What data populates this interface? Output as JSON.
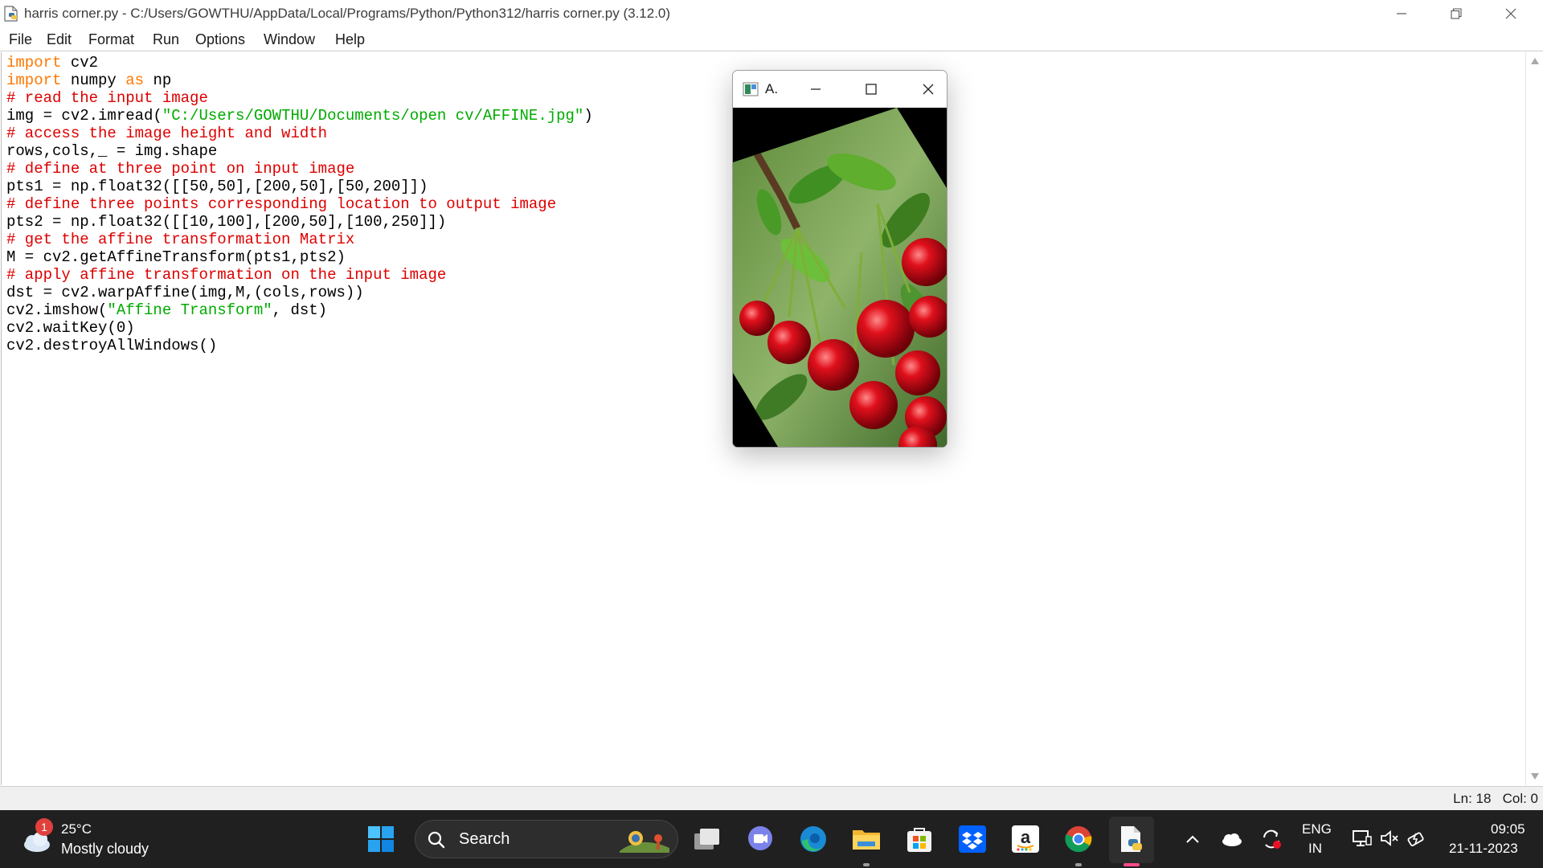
{
  "window": {
    "title": "harris corner.py - C:/Users/GOWTHU/AppData/Local/Programs/Python/Python312/harris corner.py (3.12.0)",
    "icons": [
      "python-file-icon",
      "minimize-icon",
      "restore-icon",
      "close-icon"
    ]
  },
  "menu": {
    "items": [
      "File",
      "Edit",
      "Format",
      "Run",
      "Options",
      "Window",
      "Help"
    ]
  },
  "editor": {
    "colors": {
      "keyword": "#ff7700",
      "comment": "#dd0000",
      "string": "#00aa00",
      "text": "#000000"
    },
    "lines": [
      [
        {
          "t": "kw",
          "v": "import"
        },
        {
          "t": "tx",
          "v": " cv2"
        }
      ],
      [
        {
          "t": "kw",
          "v": "import"
        },
        {
          "t": "tx",
          "v": " numpy "
        },
        {
          "t": "kw",
          "v": "as"
        },
        {
          "t": "tx",
          "v": " np"
        }
      ],
      [
        {
          "t": "cm",
          "v": "# read the input image"
        }
      ],
      [
        {
          "t": "tx",
          "v": "img = cv2.imread("
        },
        {
          "t": "st",
          "v": "\"C:/Users/GOWTHU/Documents/open cv/AFFINE.jpg\""
        },
        {
          "t": "tx",
          "v": ")"
        }
      ],
      [
        {
          "t": "cm",
          "v": "# access the image height and width"
        }
      ],
      [
        {
          "t": "tx",
          "v": "rows,cols,_ = img.shape"
        }
      ],
      [
        {
          "t": "cm",
          "v": "# define at three point on input image"
        }
      ],
      [
        {
          "t": "tx",
          "v": "pts1 = np.float32([[50,50],[200,50],[50,200]])"
        }
      ],
      [
        {
          "t": "cm",
          "v": "# define three points corresponding location to output image"
        }
      ],
      [
        {
          "t": "tx",
          "v": "pts2 = np.float32([[10,100],[200,50],[100,250]])"
        }
      ],
      [
        {
          "t": "cm",
          "v": "# get the affine transformation Matrix"
        }
      ],
      [
        {
          "t": "tx",
          "v": "M = cv2.getAffineTransform(pts1,pts2)"
        }
      ],
      [
        {
          "t": "cm",
          "v": "# apply affine transformation on the input image"
        }
      ],
      [
        {
          "t": "tx",
          "v": "dst = cv2.warpAffine(img,M,(cols,rows))"
        }
      ],
      [
        {
          "t": "tx",
          "v": "cv2.imshow("
        },
        {
          "t": "st",
          "v": "\"Affine Transform\""
        },
        {
          "t": "tx",
          "v": ", dst)"
        }
      ],
      [
        {
          "t": "tx",
          "v": "cv2.waitKey(0)"
        }
      ],
      [
        {
          "t": "tx",
          "v": "cv2.destroyAllWindows()"
        }
      ]
    ]
  },
  "status": {
    "position": "Ln: 18   Col: 0"
  },
  "cv_window": {
    "title": "A.",
    "image": "affine-transformed cherries photo",
    "icons": [
      "opencv-window-icon",
      "minimize-icon",
      "maximize-icon",
      "close-icon"
    ]
  },
  "taskbar": {
    "weather": {
      "badge": "1",
      "temp": "25°C",
      "condition": "Mostly cloudy",
      "icon": "cloud-sun-icon"
    },
    "start_icon": "windows-start-icon",
    "search": {
      "label": "Search",
      "icon": "search-icon"
    },
    "apps": [
      "task-view-icon",
      "teams-chat-icon",
      "edge-icon",
      "file-explorer-icon",
      "microsoft-store-icon",
      "dropbox-icon",
      "amazon-icon",
      "chrome-icon",
      "python-idle-icon"
    ],
    "tray": {
      "icons": [
        "chevron-up-icon",
        "onedrive-cloud-icon",
        "sync-icon",
        "display-icon",
        "volume-muted-icon",
        "battery-icon"
      ],
      "lang_top": "ENG",
      "lang_bottom": "IN",
      "time": "09:05",
      "date": "21-11-2023"
    }
  }
}
